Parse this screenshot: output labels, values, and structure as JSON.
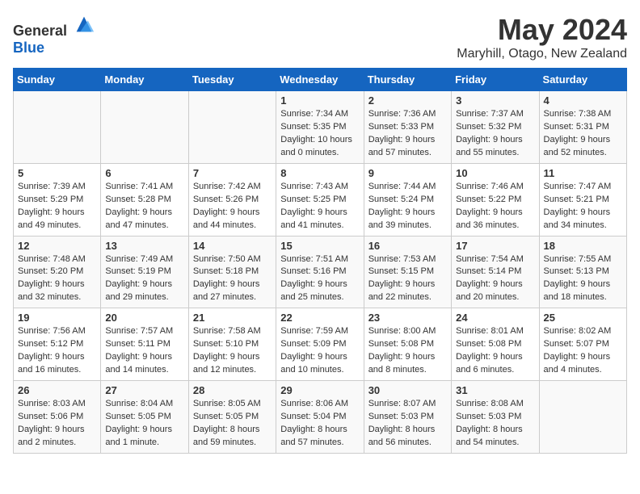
{
  "header": {
    "logo_general": "General",
    "logo_blue": "Blue",
    "month": "May 2024",
    "location": "Maryhill, Otago, New Zealand"
  },
  "weekdays": [
    "Sunday",
    "Monday",
    "Tuesday",
    "Wednesday",
    "Thursday",
    "Friday",
    "Saturday"
  ],
  "weeks": [
    [
      {
        "day": "",
        "info": ""
      },
      {
        "day": "",
        "info": ""
      },
      {
        "day": "",
        "info": ""
      },
      {
        "day": "1",
        "info": "Sunrise: 7:34 AM\nSunset: 5:35 PM\nDaylight: 10 hours\nand 0 minutes."
      },
      {
        "day": "2",
        "info": "Sunrise: 7:36 AM\nSunset: 5:33 PM\nDaylight: 9 hours\nand 57 minutes."
      },
      {
        "day": "3",
        "info": "Sunrise: 7:37 AM\nSunset: 5:32 PM\nDaylight: 9 hours\nand 55 minutes."
      },
      {
        "day": "4",
        "info": "Sunrise: 7:38 AM\nSunset: 5:31 PM\nDaylight: 9 hours\nand 52 minutes."
      }
    ],
    [
      {
        "day": "5",
        "info": "Sunrise: 7:39 AM\nSunset: 5:29 PM\nDaylight: 9 hours\nand 49 minutes."
      },
      {
        "day": "6",
        "info": "Sunrise: 7:41 AM\nSunset: 5:28 PM\nDaylight: 9 hours\nand 47 minutes."
      },
      {
        "day": "7",
        "info": "Sunrise: 7:42 AM\nSunset: 5:26 PM\nDaylight: 9 hours\nand 44 minutes."
      },
      {
        "day": "8",
        "info": "Sunrise: 7:43 AM\nSunset: 5:25 PM\nDaylight: 9 hours\nand 41 minutes."
      },
      {
        "day": "9",
        "info": "Sunrise: 7:44 AM\nSunset: 5:24 PM\nDaylight: 9 hours\nand 39 minutes."
      },
      {
        "day": "10",
        "info": "Sunrise: 7:46 AM\nSunset: 5:22 PM\nDaylight: 9 hours\nand 36 minutes."
      },
      {
        "day": "11",
        "info": "Sunrise: 7:47 AM\nSunset: 5:21 PM\nDaylight: 9 hours\nand 34 minutes."
      }
    ],
    [
      {
        "day": "12",
        "info": "Sunrise: 7:48 AM\nSunset: 5:20 PM\nDaylight: 9 hours\nand 32 minutes."
      },
      {
        "day": "13",
        "info": "Sunrise: 7:49 AM\nSunset: 5:19 PM\nDaylight: 9 hours\nand 29 minutes."
      },
      {
        "day": "14",
        "info": "Sunrise: 7:50 AM\nSunset: 5:18 PM\nDaylight: 9 hours\nand 27 minutes."
      },
      {
        "day": "15",
        "info": "Sunrise: 7:51 AM\nSunset: 5:16 PM\nDaylight: 9 hours\nand 25 minutes."
      },
      {
        "day": "16",
        "info": "Sunrise: 7:53 AM\nSunset: 5:15 PM\nDaylight: 9 hours\nand 22 minutes."
      },
      {
        "day": "17",
        "info": "Sunrise: 7:54 AM\nSunset: 5:14 PM\nDaylight: 9 hours\nand 20 minutes."
      },
      {
        "day": "18",
        "info": "Sunrise: 7:55 AM\nSunset: 5:13 PM\nDaylight: 9 hours\nand 18 minutes."
      }
    ],
    [
      {
        "day": "19",
        "info": "Sunrise: 7:56 AM\nSunset: 5:12 PM\nDaylight: 9 hours\nand 16 minutes."
      },
      {
        "day": "20",
        "info": "Sunrise: 7:57 AM\nSunset: 5:11 PM\nDaylight: 9 hours\nand 14 minutes."
      },
      {
        "day": "21",
        "info": "Sunrise: 7:58 AM\nSunset: 5:10 PM\nDaylight: 9 hours\nand 12 minutes."
      },
      {
        "day": "22",
        "info": "Sunrise: 7:59 AM\nSunset: 5:09 PM\nDaylight: 9 hours\nand 10 minutes."
      },
      {
        "day": "23",
        "info": "Sunrise: 8:00 AM\nSunset: 5:08 PM\nDaylight: 9 hours\nand 8 minutes."
      },
      {
        "day": "24",
        "info": "Sunrise: 8:01 AM\nSunset: 5:08 PM\nDaylight: 9 hours\nand 6 minutes."
      },
      {
        "day": "25",
        "info": "Sunrise: 8:02 AM\nSunset: 5:07 PM\nDaylight: 9 hours\nand 4 minutes."
      }
    ],
    [
      {
        "day": "26",
        "info": "Sunrise: 8:03 AM\nSunset: 5:06 PM\nDaylight: 9 hours\nand 2 minutes."
      },
      {
        "day": "27",
        "info": "Sunrise: 8:04 AM\nSunset: 5:05 PM\nDaylight: 9 hours\nand 1 minute."
      },
      {
        "day": "28",
        "info": "Sunrise: 8:05 AM\nSunset: 5:05 PM\nDaylight: 8 hours\nand 59 minutes."
      },
      {
        "day": "29",
        "info": "Sunrise: 8:06 AM\nSunset: 5:04 PM\nDaylight: 8 hours\nand 57 minutes."
      },
      {
        "day": "30",
        "info": "Sunrise: 8:07 AM\nSunset: 5:03 PM\nDaylight: 8 hours\nand 56 minutes."
      },
      {
        "day": "31",
        "info": "Sunrise: 8:08 AM\nSunset: 5:03 PM\nDaylight: 8 hours\nand 54 minutes."
      },
      {
        "day": "",
        "info": ""
      }
    ]
  ]
}
